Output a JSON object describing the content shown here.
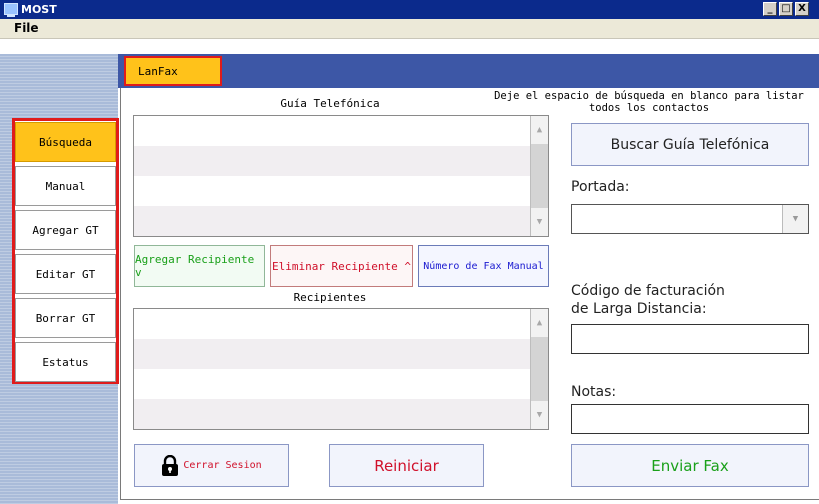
{
  "window": {
    "title": "MOST",
    "minimize": "_",
    "maximize": "□",
    "close": "X"
  },
  "menu": {
    "file": "File"
  },
  "tabs": [
    {
      "label": "LanFax"
    }
  ],
  "sidebar": {
    "items": [
      {
        "label": "Búsqueda",
        "active": true
      },
      {
        "label": "Manual"
      },
      {
        "label": "Agregar GT"
      },
      {
        "label": "Editar GT"
      },
      {
        "label": "Borrar GT"
      },
      {
        "label": "Estatus"
      }
    ]
  },
  "phonebook": {
    "label": "Guía Telefónica",
    "hint": "Deje el espacio de búsqueda en blanco para listar todos los contactos"
  },
  "buttons": {
    "add_recipient": "Agregar Recipiente v",
    "remove_recipient": "Eliminar Recipiente ^",
    "manual_fax": "Número de Fax Manual",
    "search_phonebook": "Buscar Guía Telefónica",
    "logout": "Cerrar Sesion",
    "reset": "Reiniciar",
    "send_fax": "Enviar Fax"
  },
  "recipients": {
    "label": "Recipientes"
  },
  "fields": {
    "cover_label": "Portada:",
    "billing_label_line1": "Código de facturación",
    "billing_label_line2": "de Larga Distancia:",
    "notes_label": "Notas:"
  },
  "colors": {
    "accent_tab": "#ffc21a",
    "highlight_border": "#e01b1b",
    "add_text": "#1aa01a",
    "remove_text": "#d0102a",
    "manual_text": "#1a1ad0"
  },
  "icons": {
    "logout": "lock-icon",
    "scroll_up": "triangle-up",
    "scroll_down": "triangle-down",
    "dropdown": "triangle-down"
  }
}
